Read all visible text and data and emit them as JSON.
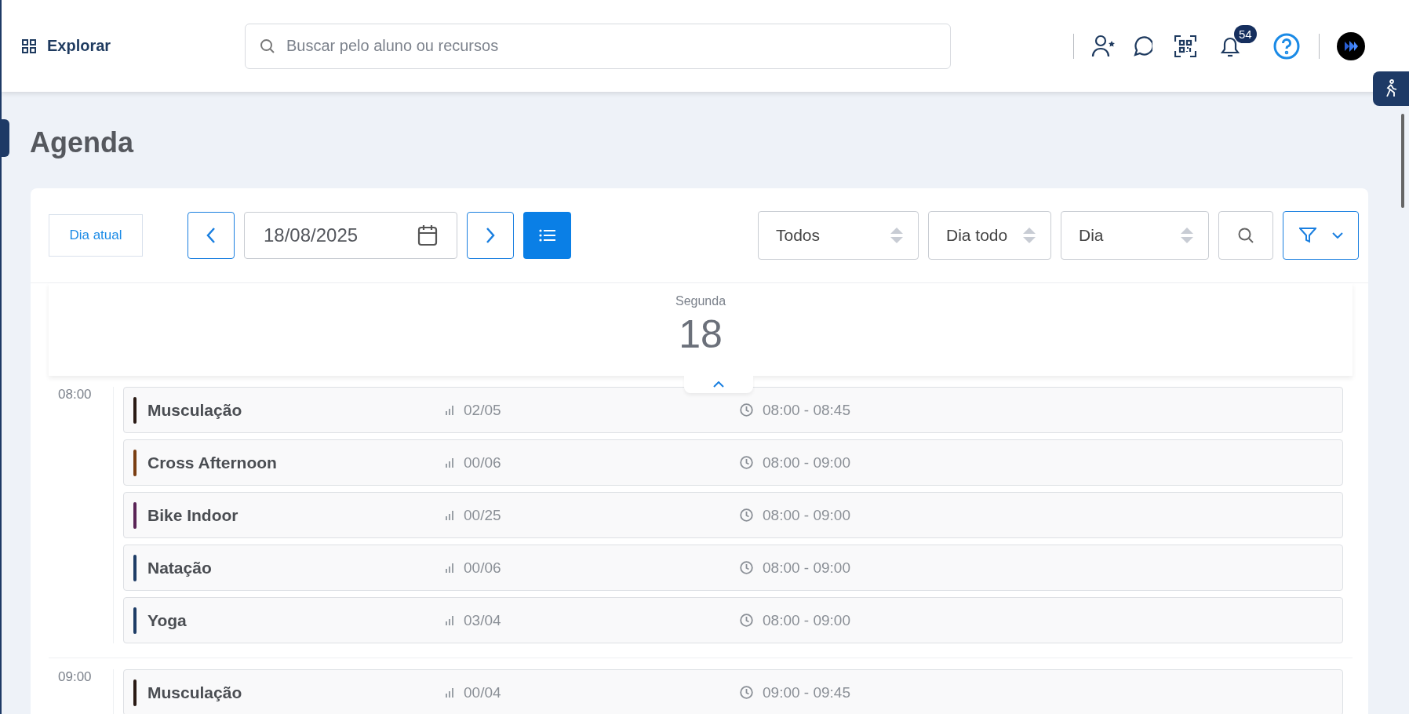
{
  "header": {
    "menu_label": "Explorar",
    "search": {
      "placeholder": "Buscar pelo aluno ou recursos"
    },
    "notifications_badge": "54"
  },
  "page_title": "Agenda",
  "toolbar": {
    "today_button": "Dia atual",
    "date": "18/08/2025",
    "selects": [
      "Todos",
      "Dia todo",
      "Dia"
    ]
  },
  "day": {
    "weekday": "Segunda",
    "number": "18"
  },
  "groups": [
    {
      "time": "08:00",
      "classes": [
        {
          "name": "Musculação",
          "color": "#2a1a14",
          "occupancy": "02/05",
          "time_range": "08:00 - 08:45"
        },
        {
          "name": "Cross Afternoon",
          "color": "#7a3e12",
          "occupancy": "00/06",
          "time_range": "08:00 - 09:00"
        },
        {
          "name": "Bike Indoor",
          "color": "#5a2456",
          "occupancy": "00/25",
          "time_range": "08:00 - 09:00"
        },
        {
          "name": "Natação",
          "color": "#1e3d66",
          "occupancy": "00/06",
          "time_range": "08:00 - 09:00"
        },
        {
          "name": "Yoga",
          "color": "#1e3d66",
          "occupancy": "03/04",
          "time_range": "08:00 - 09:00"
        }
      ]
    },
    {
      "time": "09:00",
      "classes": [
        {
          "name": "Musculação",
          "color": "#2a1a14",
          "occupancy": "00/04",
          "time_range": "09:00 - 09:45"
        }
      ]
    }
  ]
}
